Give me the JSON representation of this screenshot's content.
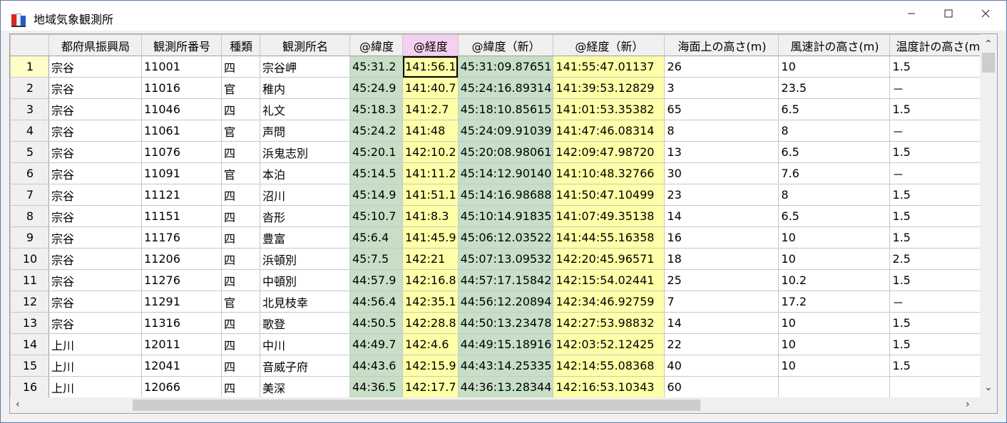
{
  "window": {
    "title": "地域気象観測所"
  },
  "columns": [
    "都府県振興局",
    "観測所番号",
    "種類",
    "観測所名",
    "@緯度",
    "@経度",
    "@緯度（新）",
    "@経度（新）",
    "海面上の高さ(m)",
    "風速計の高さ(m)",
    "温度計の高さ(m)"
  ],
  "rows": [
    [
      "宗谷",
      "11001",
      "四",
      "宗谷岬",
      "45:31.2",
      "141:56.1",
      "45:31:09.87651",
      "141:55:47.01137",
      "26",
      "10",
      "1.5"
    ],
    [
      "宗谷",
      "11016",
      "官",
      "稚内",
      "45:24.9",
      "141:40.7",
      "45:24:16.89314",
      "141:39:53.12829",
      "3",
      "23.5",
      "－"
    ],
    [
      "宗谷",
      "11046",
      "四",
      "礼文",
      "45:18.3",
      "141:2.7",
      "45:18:10.85615",
      "141:01:53.35382",
      "65",
      "6.5",
      "1.5"
    ],
    [
      "宗谷",
      "11061",
      "官",
      "声問",
      "45:24.2",
      "141:48",
      "45:24:09.91039",
      "141:47:46.08314",
      "8",
      "8",
      "－"
    ],
    [
      "宗谷",
      "11076",
      "四",
      "浜鬼志別",
      "45:20.1",
      "142:10.2",
      "45:20:08.98061",
      "142:09:47.98720",
      "13",
      "6.5",
      "1.5"
    ],
    [
      "宗谷",
      "11091",
      "官",
      "本泊",
      "45:14.5",
      "141:11.2",
      "45:14:12.90140",
      "141:10:48.32766",
      "30",
      "7.6",
      "－"
    ],
    [
      "宗谷",
      "11121",
      "四",
      "沼川",
      "45:14.9",
      "141:51.1",
      "45:14:16.98688",
      "141:50:47.10499",
      "23",
      "8",
      "1.5"
    ],
    [
      "宗谷",
      "11151",
      "四",
      "沓形",
      "45:10.7",
      "141:8.3",
      "45:10:14.91835",
      "141:07:49.35138",
      "14",
      "6.5",
      "1.5"
    ],
    [
      "宗谷",
      "11176",
      "四",
      "豊富",
      "45:6.4",
      "141:45.9",
      "45:06:12.03522",
      "141:44:55.16358",
      "16",
      "10",
      "1.5"
    ],
    [
      "宗谷",
      "11206",
      "四",
      "浜頓別",
      "45:7.5",
      "142:21",
      "45:07:13.09532",
      "142:20:45.96571",
      "18",
      "10",
      "2.5"
    ],
    [
      "宗谷",
      "11276",
      "四",
      "中頓別",
      "44:57.9",
      "142:16.8",
      "44:57:17.15842",
      "142:15:54.02441",
      "25",
      "10.2",
      "1.5"
    ],
    [
      "宗谷",
      "11291",
      "官",
      "北見枝幸",
      "44:56.4",
      "142:35.1",
      "44:56:12.20894",
      "142:34:46.92759",
      "7",
      "17.2",
      "－"
    ],
    [
      "宗谷",
      "11316",
      "四",
      "歌登",
      "44:50.5",
      "142:28.8",
      "44:50:13.23478",
      "142:27:53.98832",
      "14",
      "10",
      "1.5"
    ],
    [
      "上川",
      "12011",
      "四",
      "中川",
      "44:49.7",
      "142:4.6",
      "44:49:15.18916",
      "142:03:52.12425",
      "22",
      "10",
      "1.5"
    ],
    [
      "上川",
      "12041",
      "四",
      "音威子府",
      "44:43.6",
      "142:15.9",
      "44:43:14.25335",
      "142:14:55.08368",
      "40",
      "10",
      "1.5"
    ],
    [
      "上川",
      "12066",
      "四",
      "美深",
      "44:36.5",
      "142:17.7",
      "44:36:13.28344",
      "142:16:53.10343",
      "60",
      "",
      ""
    ]
  ],
  "row_numbers": [
    "1",
    "2",
    "3",
    "4",
    "5",
    "6",
    "7",
    "8",
    "9",
    "10",
    "11",
    "12",
    "13",
    "14",
    "15",
    "16"
  ],
  "colors": {
    "lat_fill": "#c6dfc6",
    "lon_fill": "#ffffa8",
    "lon_header": "#f6d0f0",
    "current_row_header": "#fffdc8"
  },
  "icons": {
    "app": "app-book-icon",
    "minimize": "minimize-icon",
    "maximize": "maximize-icon",
    "close": "close-icon"
  }
}
